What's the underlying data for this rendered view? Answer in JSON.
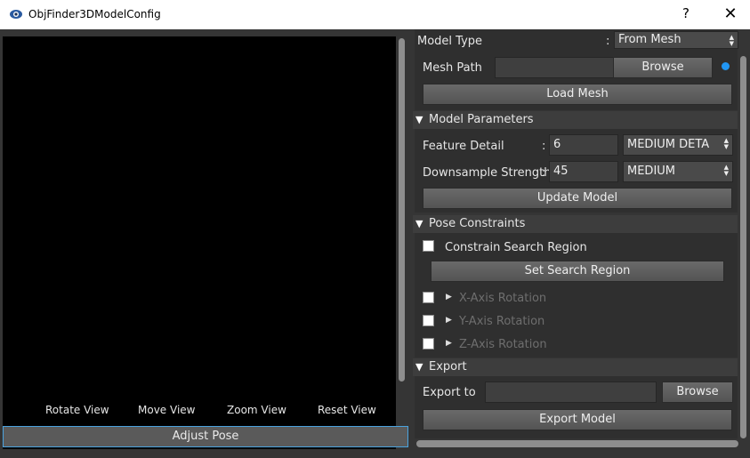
{
  "window": {
    "title": "ObjFinder3DModelConfig",
    "help_label": "?",
    "close_label": "✕"
  },
  "viewport": {
    "view_buttons": [
      "Rotate View",
      "Move View",
      "Zoom View",
      "Reset View"
    ],
    "adjust_pose_label": "Adjust Pose"
  },
  "model": {
    "type_label": "Model Type",
    "type_sep": ":",
    "type_value": "From Mesh",
    "mesh_path_label": "Mesh Path",
    "mesh_path_value": "",
    "browse_label": "Browse",
    "load_label": "Load Mesh",
    "status_color": "#2196f3"
  },
  "params": {
    "header": "Model Parameters",
    "feature_label": "Feature Detail",
    "feature_sep": ":",
    "feature_value": "6",
    "feature_combo": "MEDIUM DETA",
    "downsample_label": "Downsample Strength",
    "downsample_sep": ":",
    "downsample_value": "45",
    "downsample_combo": "MEDIUM",
    "update_label": "Update Model"
  },
  "pose": {
    "header": "Pose Constraints",
    "constrain_label": "Constrain Search Region",
    "set_region_label": "Set Search Region",
    "axes": [
      "X-Axis Rotation",
      "Y-Axis Rotation",
      "Z-Axis Rotation"
    ]
  },
  "export": {
    "header": "Export",
    "to_label": "Export to",
    "path_value": "",
    "browse_label": "Browse",
    "export_label": "Export Model"
  },
  "icons": {
    "header_expanded": "▼",
    "axis_collapsed": "▶"
  }
}
